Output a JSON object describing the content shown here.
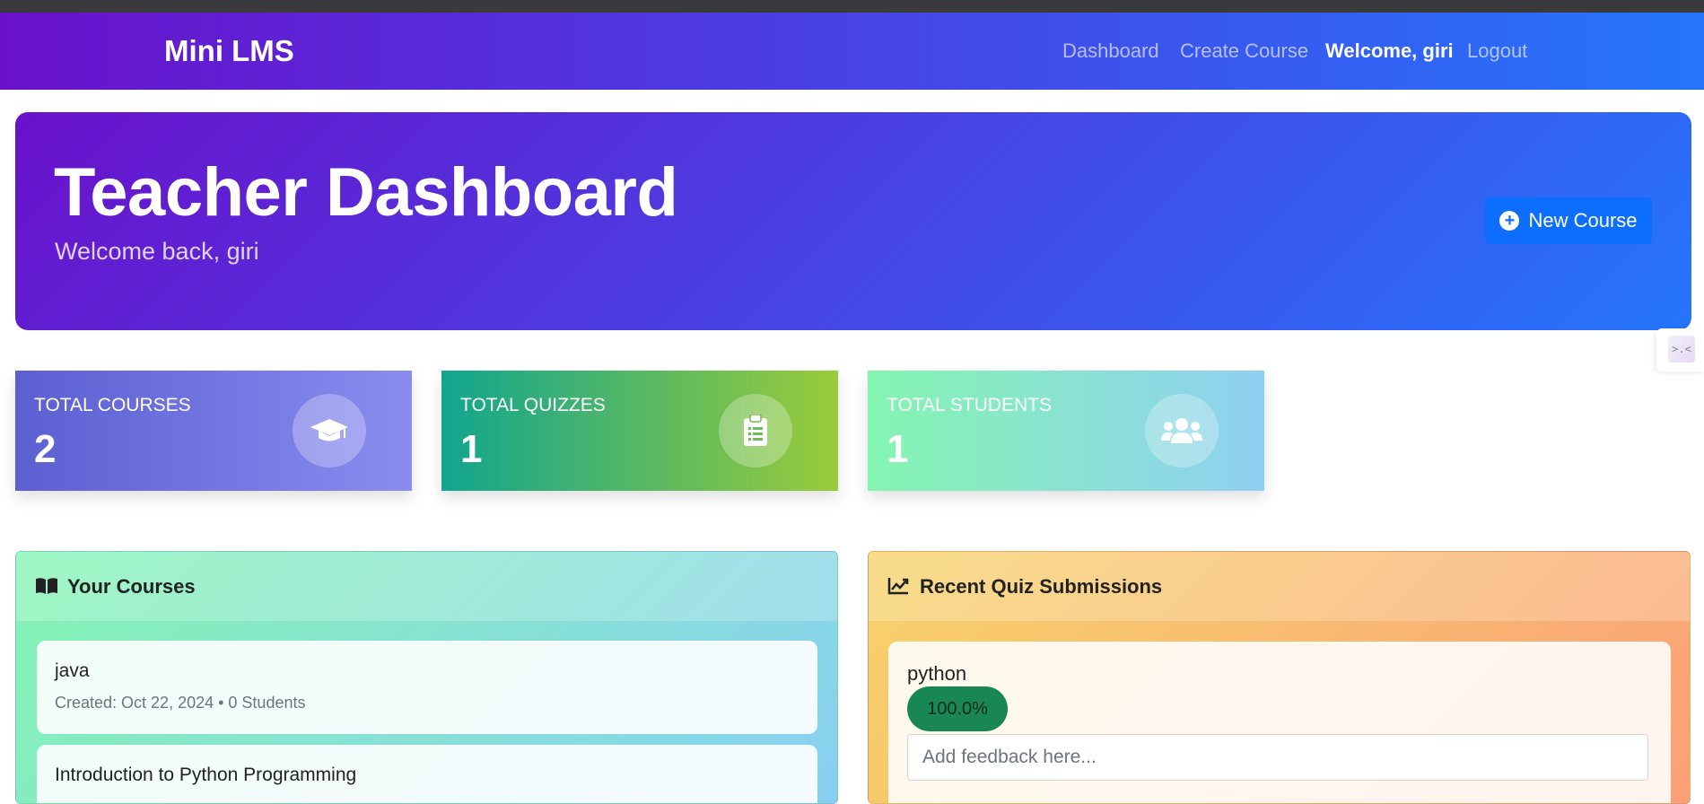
{
  "navbar": {
    "brand": "Mini LMS",
    "links": {
      "dashboard": "Dashboard",
      "create_course": "Create Course",
      "welcome": "Welcome, giri",
      "logout": "Logout"
    }
  },
  "hero": {
    "title": "Teacher Dashboard",
    "subtitle": "Welcome back, giri",
    "new_course_label": "New Course",
    "new_course_icon": "plus-circle-icon"
  },
  "stats": [
    {
      "label": "TOTAL COURSES",
      "value": "2",
      "icon": "graduation-cap-icon"
    },
    {
      "label": "TOTAL QUIZZES",
      "value": "1",
      "icon": "clipboard-list-icon"
    },
    {
      "label": "TOTAL STUDENTS",
      "value": "1",
      "icon": "users-icon"
    }
  ],
  "courses_panel": {
    "title": "Your Courses",
    "icon": "book-open-icon",
    "items": [
      {
        "name": "java",
        "meta": "Created: Oct 22, 2024 • 0 Students"
      },
      {
        "name": "Introduction to Python Programming",
        "meta": ""
      }
    ]
  },
  "submissions_panel": {
    "title": "Recent Quiz Submissions",
    "icon": "chart-line-icon",
    "items": [
      {
        "name": "python",
        "score": "100.0%",
        "feedback_placeholder": "Add feedback here..."
      }
    ]
  },
  "colors": {
    "nav_gradient_start": "#6a11cb",
    "nav_gradient_end": "#2575fc",
    "primary_button": "#0d6efd",
    "success_badge": "#198754"
  }
}
